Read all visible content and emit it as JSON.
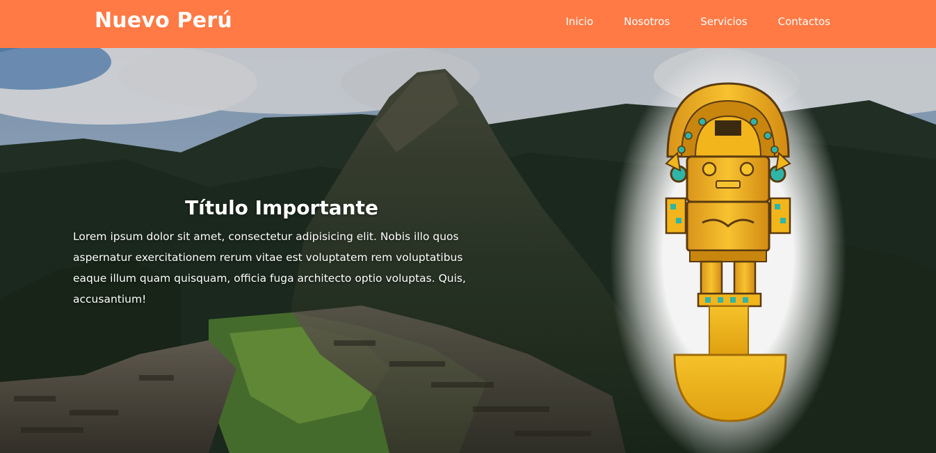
{
  "header": {
    "brand": "Nuevo Perú",
    "nav": [
      "Inicio",
      "Nosotros",
      "Servicios",
      "Contactos"
    ]
  },
  "hero": {
    "title": "Título Importante",
    "body": "Lorem ipsum dolor sit amet, consectetur adipisicing elit. Nobis illo quos aspernatur exercitationem rerum vitae est voluptatem rem voluptatibus eaque illum quam quisquam, officia fuga architecto optio voluptas. Quis, accusantium!"
  },
  "colors": {
    "header_bg": "#ff7a45",
    "header_text": "#ffffff",
    "tumi_gold": "#f2b51c"
  },
  "images": {
    "background": "machu-picchu-landscape",
    "illustration": "tumi-figure"
  }
}
